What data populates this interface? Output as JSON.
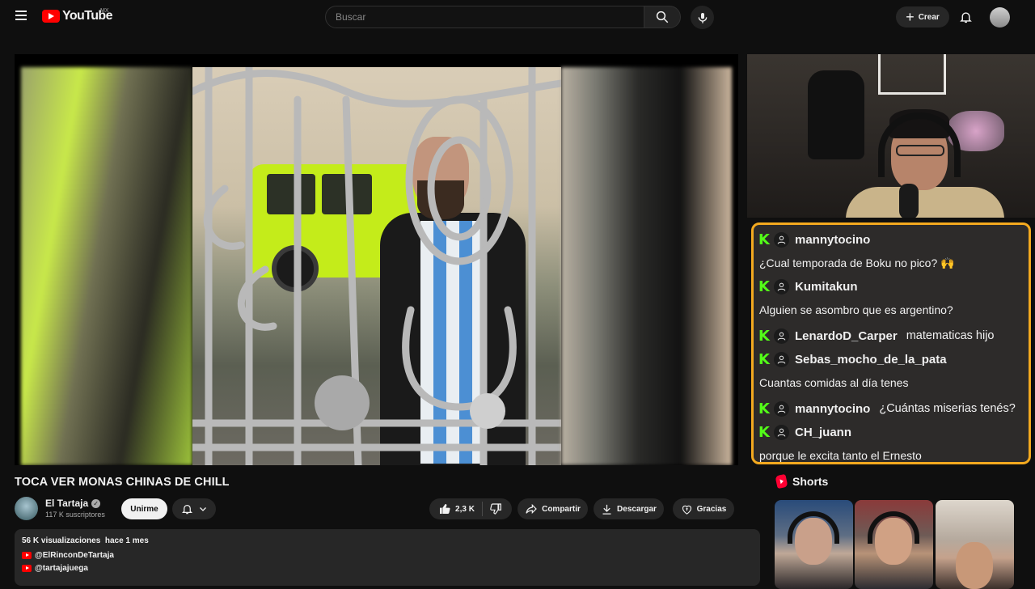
{
  "header": {
    "logo_text": "YouTube",
    "country": "MX",
    "search_placeholder": "Buscar",
    "create_label": "Crear"
  },
  "video": {
    "title": "TOCA VER MONAS CHINAS DE CHILL",
    "channel_name": "El Tartaja",
    "subscribers": "117 K suscriptores",
    "join_label": "Unirme",
    "likes": "2,3 K",
    "share_label": "Compartir",
    "download_label": "Descargar",
    "thanks_label": "Gracias"
  },
  "description": {
    "views": "56 K visualizaciones",
    "date": "hace 1 mes",
    "links": [
      "@ElRinconDeTartaja",
      "@tartajajuega"
    ]
  },
  "chat": {
    "messages": [
      {
        "user": "mannytocino",
        "text": "¿Cual temporada de Boku no pico? 🙌"
      },
      {
        "user": "Kumitakun",
        "text": "Alguien se asombro que es argentino?"
      },
      {
        "user": "LenardoD_Carper",
        "text": "matematicas hijo"
      },
      {
        "user": "Sebas_mocho_de_la_pata",
        "text": "Cuantas comidas al día tenes"
      },
      {
        "user": "mannytocino",
        "text": "¿Cuántas miserias tenés?"
      },
      {
        "user": "CH_juann",
        "text": "porque le excita tanto el Ernesto"
      }
    ]
  },
  "shorts": {
    "heading": "Shorts"
  },
  "colors": {
    "accent_red": "#ff0000",
    "chat_border": "#f3a91f",
    "kick_green": "#53fc18"
  }
}
